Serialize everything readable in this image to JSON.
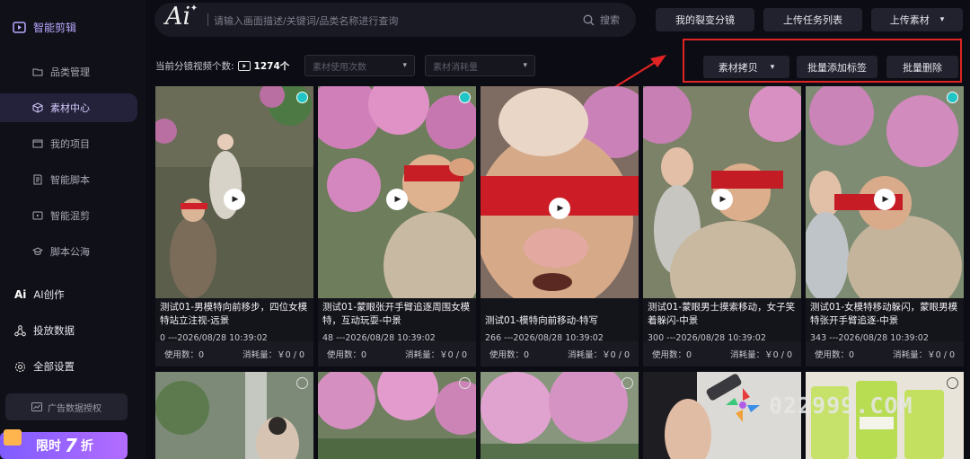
{
  "sidebar": {
    "header": "智能剪辑",
    "items": [
      {
        "label": "品类管理",
        "icon": "folder-icon",
        "active": false
      },
      {
        "label": "素材中心",
        "icon": "cube-icon",
        "active": true
      },
      {
        "label": "我的项目",
        "icon": "project-icon",
        "active": false
      },
      {
        "label": "智能脚本",
        "icon": "script-icon",
        "active": false
      },
      {
        "label": "智能混剪",
        "icon": "mix-icon",
        "active": false
      },
      {
        "label": "脚本公海",
        "icon": "graduation-icon",
        "active": false
      }
    ],
    "top_items": [
      {
        "label": "AI创作",
        "icon": "ai-icon"
      },
      {
        "label": "投放数据",
        "icon": "network-icon"
      },
      {
        "label": "全部设置",
        "icon": "gear-icon"
      }
    ],
    "ad_auth": "广告数据授权",
    "promo": {
      "prefix": "限时",
      "number": "7",
      "suffix": "折"
    }
  },
  "header": {
    "logo": "Ai",
    "search_placeholder": "请输入画面描述/关键词/品类名称进行查询",
    "search_button": "搜索",
    "buttons": [
      "我的裂变分镜",
      "上传任务列表"
    ],
    "upload": "上传素材"
  },
  "toolbar": {
    "count_label": "当前分镜视频个数:",
    "count_value": "1274个",
    "filter1": "素材使用次数",
    "filter2": "素材消耗量",
    "copy": "素材拷贝",
    "batch_tag": "批量添加标签",
    "batch_delete": "批量删除"
  },
  "cards": [
    {
      "title": "测试01-男模特向前移步，四位女模特站立注视-远景",
      "meta": "0 ---2026/08/28 10:39:02",
      "used_label": "使用数：0",
      "cost_label": "消耗量：￥0 / 0",
      "checked": true
    },
    {
      "title": "测试01-蒙眼张开手臂追逐周围女模特，互动玩耍-中景",
      "meta": "48 ---2026/08/28 10:39:02",
      "used_label": "使用数：0",
      "cost_label": "消耗量：￥0 / 0",
      "checked": true
    },
    {
      "title": "测试01-模特向前移动-特写",
      "meta": "266 ---2026/08/28 10:39:02",
      "used_label": "使用数：0",
      "cost_label": "消耗量：￥0 / 0",
      "checked": false
    },
    {
      "title": "测试01-蒙眼男士摸索移动，女子笑着躲闪-中景",
      "meta": "300 ---2026/08/28 10:39:02",
      "used_label": "使用数：0",
      "cost_label": "消耗量：￥0 / 0",
      "checked": true
    },
    {
      "title": "测试01-女模特移动躲闪，蒙眼男模特张开手臂追逐-中景",
      "meta": "343 ---2026/08/28 10:39:02",
      "used_label": "使用数：0",
      "cost_label": "消耗量：￥0 / 0",
      "checked": true
    }
  ],
  "watermark": "022999.COM"
}
